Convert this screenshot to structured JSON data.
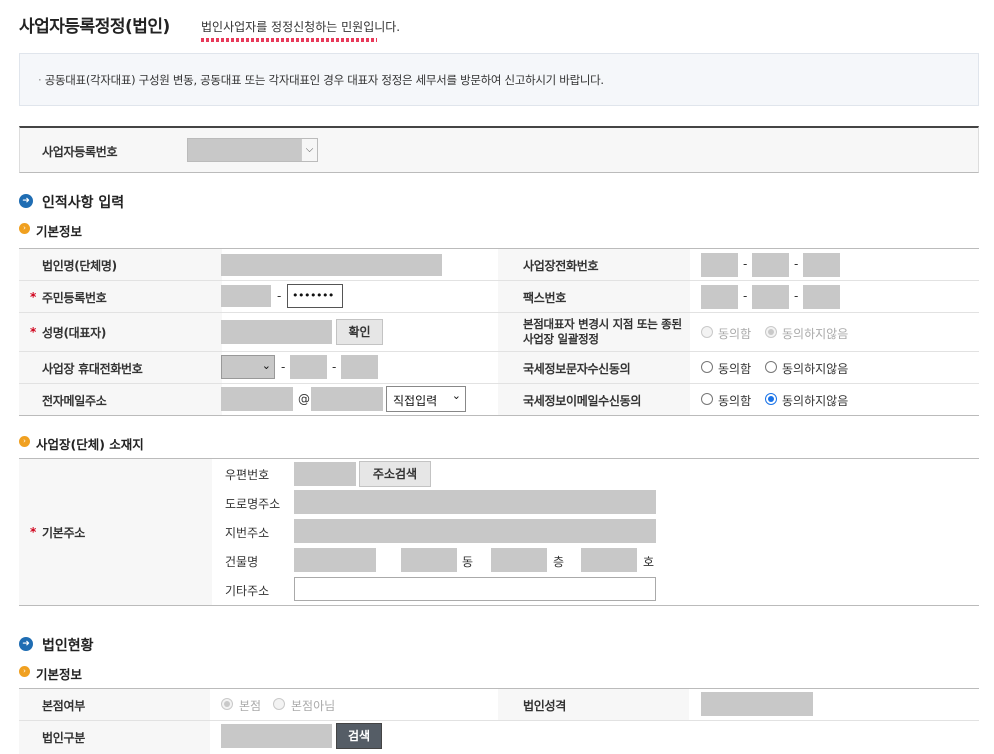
{
  "page": {
    "title": "사업자등록정정(법인)",
    "subtitle": "법인사업자를 정정신청하는 민원입니다."
  },
  "notice": "공동대표(각자대표) 구성원 변동, 공동대표 또는 각자대표인 경우 대표자 정정은 세무서를 방문하여 신고하시기 바랍니다.",
  "biz": {
    "label": "사업자등록번호"
  },
  "section1": {
    "title": "인적사항 입력",
    "sub1": "기본정보",
    "labels": {
      "corp_name": "법인명(단체명)",
      "rrn": "주민등록번호",
      "rep_name": "성명(대표자)",
      "mobile": "사업장 휴대전화번호",
      "email": "전자메일주소",
      "biz_phone": "사업장전화번호",
      "fax": "팩스번호",
      "branch_change": "본점대표자 변경시 지점 또는 종된사업장 일괄정정",
      "sms_consent": "국세정보문자수신동의",
      "email_consent": "국세정보이메일수신동의"
    },
    "rrn_masked": "•••••••",
    "confirm_btn": "확인",
    "email_at": "@",
    "email_domain_select": "직접입력",
    "dash": "-",
    "agree": "동의함",
    "disagree": "동의하지않음",
    "sub2": "사업장(단체) 소재지",
    "addr": {
      "label": "기본주소",
      "zip": "우편번호",
      "search_btn": "주소검색",
      "road": "도로명주소",
      "jibun": "지번주소",
      "building": "건물명",
      "dong": "동",
      "floor": "층",
      "ho": "호",
      "etc": "기타주소"
    }
  },
  "section2": {
    "title": "법인현황",
    "sub1": "기본정보",
    "labels": {
      "hq": "본점여부",
      "corp_type": "법인성격",
      "corp_class": "법인구분"
    },
    "hq_yes": "본점",
    "hq_no": "본점아님",
    "search_btn": "검색"
  },
  "icons": {
    "section": "arrow-right-circle-icon",
    "sub": "chevron-right-circle-icon",
    "select": "chevron-down-icon"
  },
  "colors": {
    "accent": "#1a73e8",
    "required": "#d0021b",
    "section_icon": "#1f6db3",
    "sub_icon": "#f0a020"
  }
}
